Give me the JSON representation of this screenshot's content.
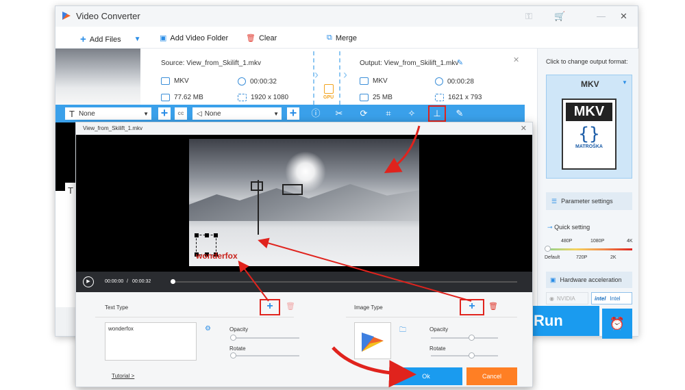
{
  "app": {
    "title": "Video Converter"
  },
  "toolbar": {
    "add_files": "Add Files",
    "add_video_folder": "Add Video Folder",
    "clear": "Clear",
    "merge": "Merge"
  },
  "file": {
    "source": "Source: View_from_Skilift_1.mkv",
    "output": "Output: View_from_Skilift_1.mkv",
    "src_format": "MKV",
    "src_duration": "00:00:32",
    "src_size": "77.62 MB",
    "src_resolution": "1920 x 1080",
    "gpu": "GPU",
    "out_format": "MKV",
    "out_duration": "00:00:28",
    "out_size": "25 MB",
    "out_resolution": "1621 x 793"
  },
  "editbar": {
    "subtitle_value": "None",
    "audio_value": "None",
    "cc_label": "cc"
  },
  "right_panel": {
    "change_format_label": "Click to change output format:",
    "format_selected": "MKV",
    "format_logo_text": "MKV",
    "format_logo_brand": "MATROŠKA",
    "parameter_settings": "Parameter settings",
    "quick_setting": "Quick setting",
    "quality_top": [
      "480P",
      "1080P",
      "4K"
    ],
    "quality_bottom": [
      "Default",
      "720P",
      "2K"
    ],
    "hardware_acceleration": "Hardware acceleration",
    "nvidia": "NVIDIA",
    "intel": "Intel",
    "run": "Run"
  },
  "dialog": {
    "title": "View_from_Skilift_1.mkv",
    "time_current": "00:00:00",
    "time_sep": "/",
    "time_total": "00:00:32",
    "watermark_text": "wonderfox",
    "text_type_label": "Text Type",
    "image_type_label": "Image Type",
    "text_input_value": "wonderfox",
    "opacity_label": "Opacity",
    "rotate_label": "Rotate",
    "tutorial_link": "Tutorial >",
    "ok_label": "Ok",
    "cancel_label": "Cancel"
  },
  "colors": {
    "accent": "#1a9bef",
    "cancel": "#ff7f24",
    "highlight": "#e0231d"
  }
}
